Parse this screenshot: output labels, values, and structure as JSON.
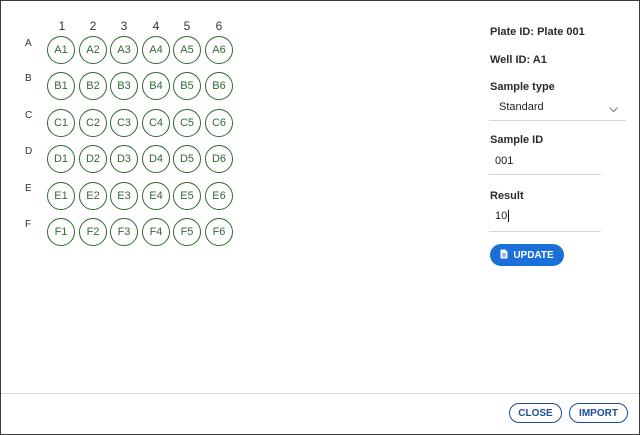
{
  "plate": {
    "columns": [
      "1",
      "2",
      "3",
      "4",
      "5",
      "6"
    ],
    "rows": [
      {
        "label": "A",
        "wells": [
          "A1",
          "A2",
          "A3",
          "A4",
          "A5",
          "A6"
        ]
      },
      {
        "label": "B",
        "wells": [
          "B1",
          "B2",
          "B3",
          "B4",
          "B5",
          "B6"
        ]
      },
      {
        "label": "C",
        "wells": [
          "C1",
          "C2",
          "C3",
          "C4",
          "C5",
          "C6"
        ]
      },
      {
        "label": "D",
        "wells": [
          "D1",
          "D2",
          "D3",
          "D4",
          "D5",
          "D6"
        ]
      },
      {
        "label": "E",
        "wells": [
          "E1",
          "E2",
          "E3",
          "E4",
          "E5",
          "E6"
        ]
      },
      {
        "label": "F",
        "wells": [
          "F1",
          "F2",
          "F3",
          "F4",
          "F5",
          "F6"
        ]
      }
    ]
  },
  "panel": {
    "plate_id": "Plate ID: Plate 001",
    "well_id": "Well ID: A1",
    "sample_type_label": "Sample type",
    "sample_type_value": "Standard",
    "sample_id_label": "Sample ID",
    "sample_id_value": "001",
    "result_label": "Result",
    "result_value": "10",
    "update_label": "UPDATE"
  },
  "footer": {
    "close_label": "CLOSE",
    "import_label": "IMPORT"
  },
  "colors": {
    "well_green": "#2e6b2e",
    "primary_blue": "#1a6fd8",
    "outline_blue": "#1a4d9c"
  }
}
